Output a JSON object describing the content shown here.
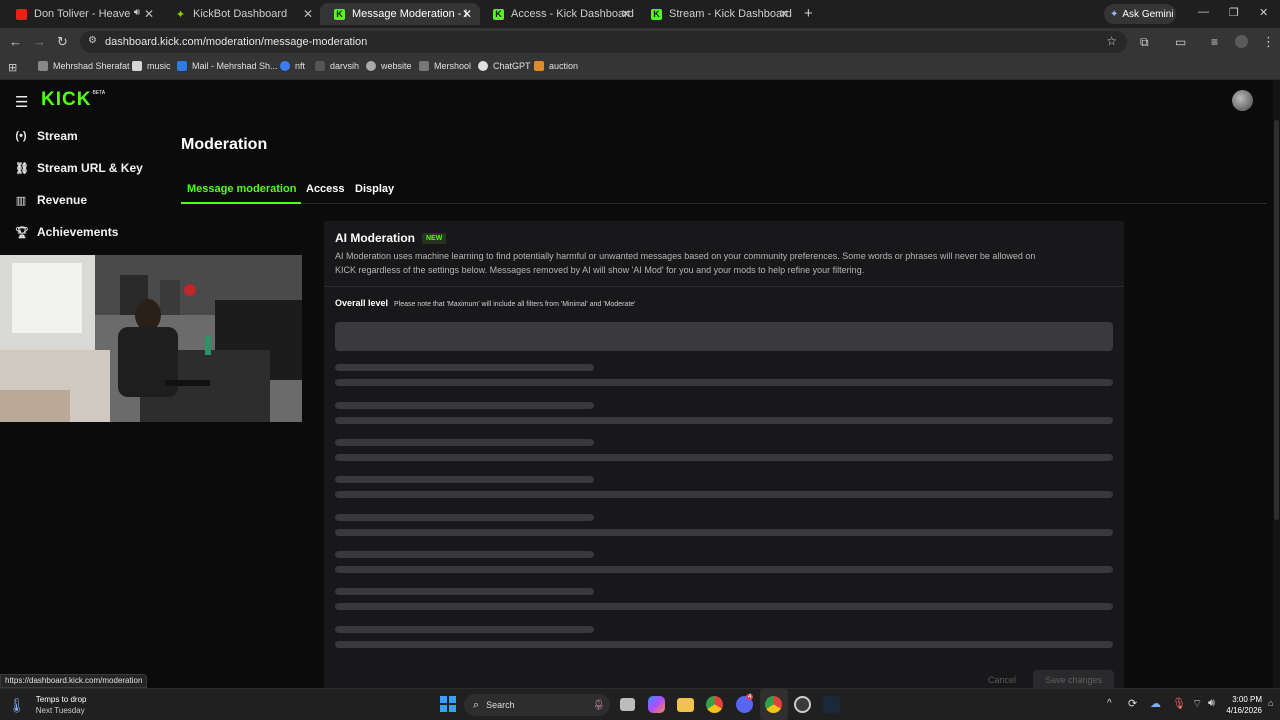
{
  "browser": {
    "tabs": [
      {
        "title": "Don Toliver - Heaven Or He",
        "favicon": "youtube-icon"
      },
      {
        "title": "KickBot Dashboard",
        "favicon": "kickbot-icon"
      },
      {
        "title": "Message Moderation - Kick Da",
        "favicon": "kick-icon",
        "active": true
      },
      {
        "title": "Access - Kick Dashboard",
        "favicon": "kick-icon"
      },
      {
        "title": "Stream - Kick Dashboard",
        "favicon": "kick-icon"
      }
    ],
    "ask_gemini": "Ask Gemini",
    "url": "dashboard.kick.com/moderation/message-moderation",
    "bookmarks": [
      "Mehrshad Sherafat",
      "music",
      "Mail - Mehrshad Sh...",
      "nft",
      "darvsih",
      "website",
      "Mershool",
      "ChatGPT",
      "auction"
    ]
  },
  "app": {
    "logo": "KICK",
    "logo_badge": "BETA",
    "sidebar": [
      {
        "label": "Stream",
        "icon": "broadcast-icon"
      },
      {
        "label": "Stream URL & Key",
        "icon": "link-icon"
      },
      {
        "label": "Revenue",
        "icon": "chart-icon"
      },
      {
        "label": "Achievements",
        "icon": "trophy-icon"
      }
    ],
    "page_title": "Moderation",
    "tabs": [
      "Message moderation",
      "Access",
      "Display"
    ],
    "active_tab": "Message moderation",
    "ai_moderation": {
      "title": "AI Moderation",
      "badge": "NEW",
      "description_line1": "AI Moderation uses machine learning to find potentially harmful or unwanted messages based on your community preferences. Some words or phrases will never be allowed on",
      "description_line2": "KICK regardless of the settings below. Messages removed by AI will show 'AI Mod' for you and your mods to help refine your filtering.",
      "overall_label": "Overall level",
      "overall_note": "Please note that 'Maximum' will include all filters from 'Minimal' and 'Moderate'",
      "cancel_label": "Cancel",
      "save_label": "Save changes"
    },
    "accent": "#53fc18"
  },
  "status_url": "https://dashboard.kick.com/moderation",
  "taskbar": {
    "weather_title": "Temps to drop",
    "weather_sub": "Next Tuesday",
    "search_placeholder": "Search",
    "time": "3:00 PM",
    "date": "4/16/2026",
    "discord_badge": "4"
  }
}
